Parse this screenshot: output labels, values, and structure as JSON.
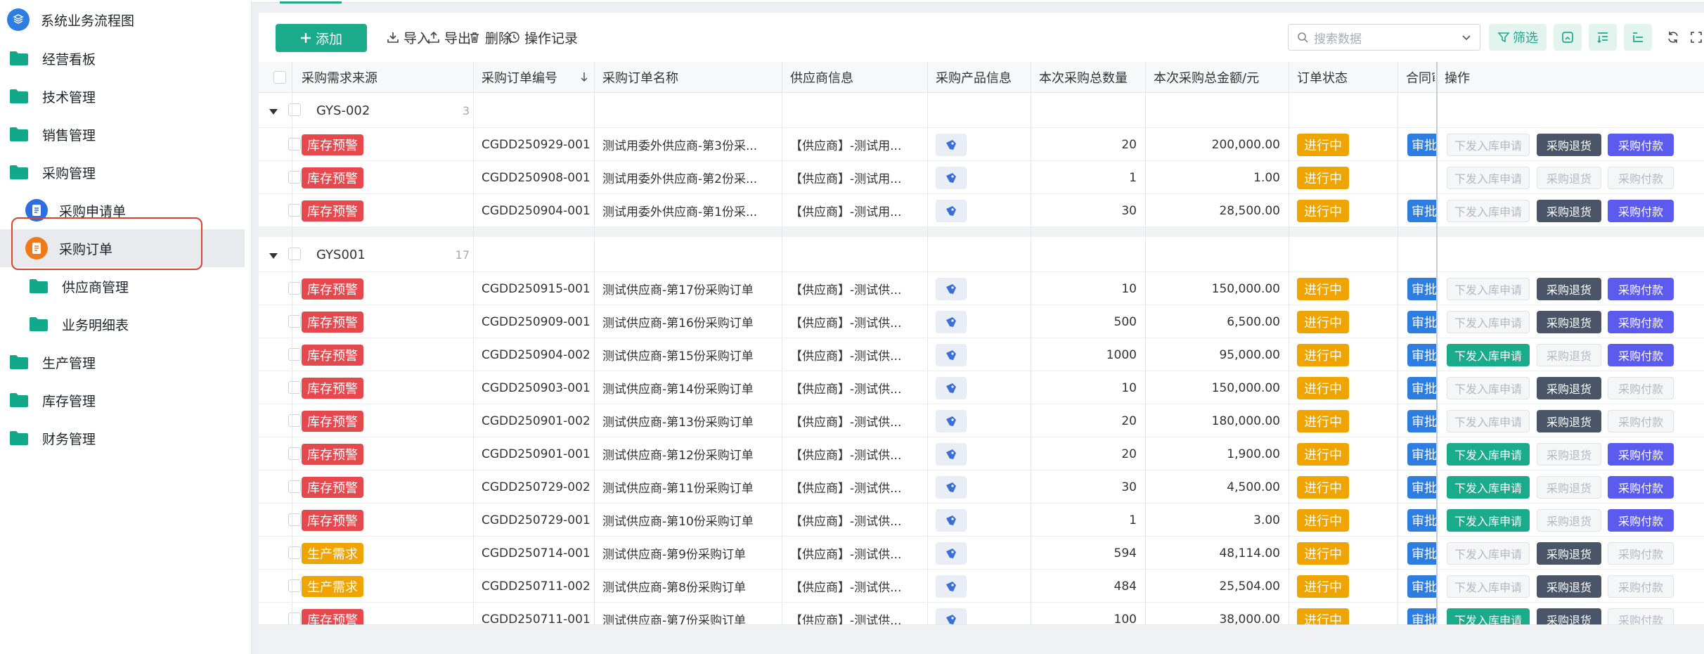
{
  "sidebar": {
    "items": [
      {
        "label": "系统业务流程图",
        "icon": "flowchart-icon"
      },
      {
        "label": "经营看板",
        "icon": "folder-icon"
      },
      {
        "label": "技术管理",
        "icon": "folder-icon"
      },
      {
        "label": "销售管理",
        "icon": "folder-icon"
      },
      {
        "label": "采购管理",
        "icon": "folder-icon"
      },
      {
        "label": "采购申请单",
        "icon": "document-icon"
      },
      {
        "label": "采购订单",
        "icon": "document-icon"
      },
      {
        "label": "供应商管理",
        "icon": "folder-icon"
      },
      {
        "label": "业务明细表",
        "icon": "folder-icon"
      },
      {
        "label": "生产管理",
        "icon": "folder-icon"
      },
      {
        "label": "库存管理",
        "icon": "folder-icon"
      },
      {
        "label": "财务管理",
        "icon": "folder-icon"
      }
    ]
  },
  "toolbar": {
    "add_label": "添加",
    "import_label": "导入",
    "export_label": "导出",
    "delete_label": "删除",
    "log_label": "操作记录",
    "search_placeholder": "搜索数据",
    "filter_label": "筛选"
  },
  "table": {
    "columns": [
      "采购需求来源",
      "采购订单编号",
      "采购订单名称",
      "供应商信息",
      "采购产品信息",
      "本次采购总数量",
      "本次采购总金额/元",
      "订单状态",
      "合同审批",
      "操作"
    ],
    "actions": [
      "下发入库申请",
      "采购退货",
      "采购付款"
    ],
    "groups": [
      {
        "name": "GYS-002",
        "count": "3",
        "rows": [
          {
            "source": "库存预警",
            "source_type": "red",
            "code": "CGDD250929-001",
            "name": "测试用委外供应商-第3份采...",
            "supplier": "【供应商】-测试用...",
            "qty": "20",
            "amount": "200,000.00",
            "status": "进行中",
            "approval": "审批通过",
            "act": [
              "disabled",
              "dark",
              "purple"
            ]
          },
          {
            "source": "库存预警",
            "source_type": "red",
            "code": "CGDD250908-001",
            "name": "测试用委外供应商-第2份采...",
            "supplier": "【供应商】-测试用...",
            "qty": "1",
            "amount": "1.00",
            "status": "进行中",
            "approval": "",
            "act": [
              "disabled",
              "disabled",
              "disabled"
            ]
          },
          {
            "source": "库存预警",
            "source_type": "red",
            "code": "CGDD250904-001",
            "name": "测试用委外供应商-第1份采...",
            "supplier": "【供应商】-测试用...",
            "qty": "30",
            "amount": "28,500.00",
            "status": "进行中",
            "approval": "审批通过",
            "act": [
              "disabled",
              "dark",
              "purple"
            ]
          }
        ]
      },
      {
        "name": "GYS001",
        "count": "17",
        "rows": [
          {
            "source": "库存预警",
            "source_type": "red",
            "code": "CGDD250915-001",
            "name": "测试供应商-第17份采购订单",
            "supplier": "【供应商】-测试供...",
            "qty": "10",
            "amount": "150,000.00",
            "status": "进行中",
            "approval": "审批通过",
            "act": [
              "disabled",
              "dark",
              "purple"
            ]
          },
          {
            "source": "库存预警",
            "source_type": "red",
            "code": "CGDD250909-001",
            "name": "测试供应商-第16份采购订单",
            "supplier": "【供应商】-测试供...",
            "qty": "500",
            "amount": "6,500.00",
            "status": "进行中",
            "approval": "审批通过",
            "act": [
              "disabled",
              "dark",
              "purple"
            ]
          },
          {
            "source": "库存预警",
            "source_type": "red",
            "code": "CGDD250904-002",
            "name": "测试供应商-第15份采购订单",
            "supplier": "【供应商】-测试供...",
            "qty": "1000",
            "amount": "95,000.00",
            "status": "进行中",
            "approval": "审批通过",
            "act": [
              "green",
              "disabled",
              "purple"
            ]
          },
          {
            "source": "库存预警",
            "source_type": "red",
            "code": "CGDD250903-001",
            "name": "测试供应商-第14份采购订单",
            "supplier": "【供应商】-测试供...",
            "qty": "10",
            "amount": "150,000.00",
            "status": "进行中",
            "approval": "审批通过",
            "act": [
              "disabled",
              "dark",
              "disabled"
            ]
          },
          {
            "source": "库存预警",
            "source_type": "red",
            "code": "CGDD250901-002",
            "name": "测试供应商-第13份采购订单",
            "supplier": "【供应商】-测试供...",
            "qty": "20",
            "amount": "180,000.00",
            "status": "进行中",
            "approval": "审批通过",
            "act": [
              "disabled",
              "dark",
              "disabled"
            ]
          },
          {
            "source": "库存预警",
            "source_type": "red",
            "code": "CGDD250901-001",
            "name": "测试供应商-第12份采购订单",
            "supplier": "【供应商】-测试供...",
            "qty": "20",
            "amount": "1,900.00",
            "status": "进行中",
            "approval": "审批通过",
            "act": [
              "green",
              "disabled",
              "purple"
            ]
          },
          {
            "source": "库存预警",
            "source_type": "red",
            "code": "CGDD250729-002",
            "name": "测试供应商-第11份采购订单",
            "supplier": "【供应商】-测试供...",
            "qty": "30",
            "amount": "4,500.00",
            "status": "进行中",
            "approval": "审批通过",
            "act": [
              "green",
              "disabled",
              "purple"
            ]
          },
          {
            "source": "库存预警",
            "source_type": "red",
            "code": "CGDD250729-001",
            "name": "测试供应商-第10份采购订单",
            "supplier": "【供应商】-测试供...",
            "qty": "1",
            "amount": "3.00",
            "status": "进行中",
            "approval": "审批通过",
            "act": [
              "green",
              "disabled",
              "purple"
            ]
          },
          {
            "source": "生产需求",
            "source_type": "orange",
            "code": "CGDD250714-001",
            "name": "测试供应商-第9份采购订单",
            "supplier": "【供应商】-测试供...",
            "qty": "594",
            "amount": "48,114.00",
            "status": "进行中",
            "approval": "审批通过",
            "act": [
              "disabled",
              "dark",
              "disabled"
            ]
          },
          {
            "source": "生产需求",
            "source_type": "orange",
            "code": "CGDD250711-002",
            "name": "测试供应商-第8份采购订单",
            "supplier": "【供应商】-测试供...",
            "qty": "484",
            "amount": "25,504.00",
            "status": "进行中",
            "approval": "审批通过",
            "act": [
              "disabled",
              "dark",
              "disabled"
            ]
          },
          {
            "source": "库存预警",
            "source_type": "red",
            "code": "CGDD250711-001",
            "name": "测试供应商-第7份采购订单",
            "supplier": "【供应商】-测试供...",
            "qty": "100",
            "amount": "38,000.00",
            "status": "进行中",
            "approval": "审批通过",
            "act": [
              "green",
              "dark",
              "disabled"
            ]
          }
        ]
      }
    ]
  },
  "colors": {
    "accent": "#1aab8a",
    "red": "#e5484d",
    "orange": "#f0a400",
    "blue": "#2e7de0",
    "purple": "#5b5bf0",
    "dark": "#4a5668"
  }
}
